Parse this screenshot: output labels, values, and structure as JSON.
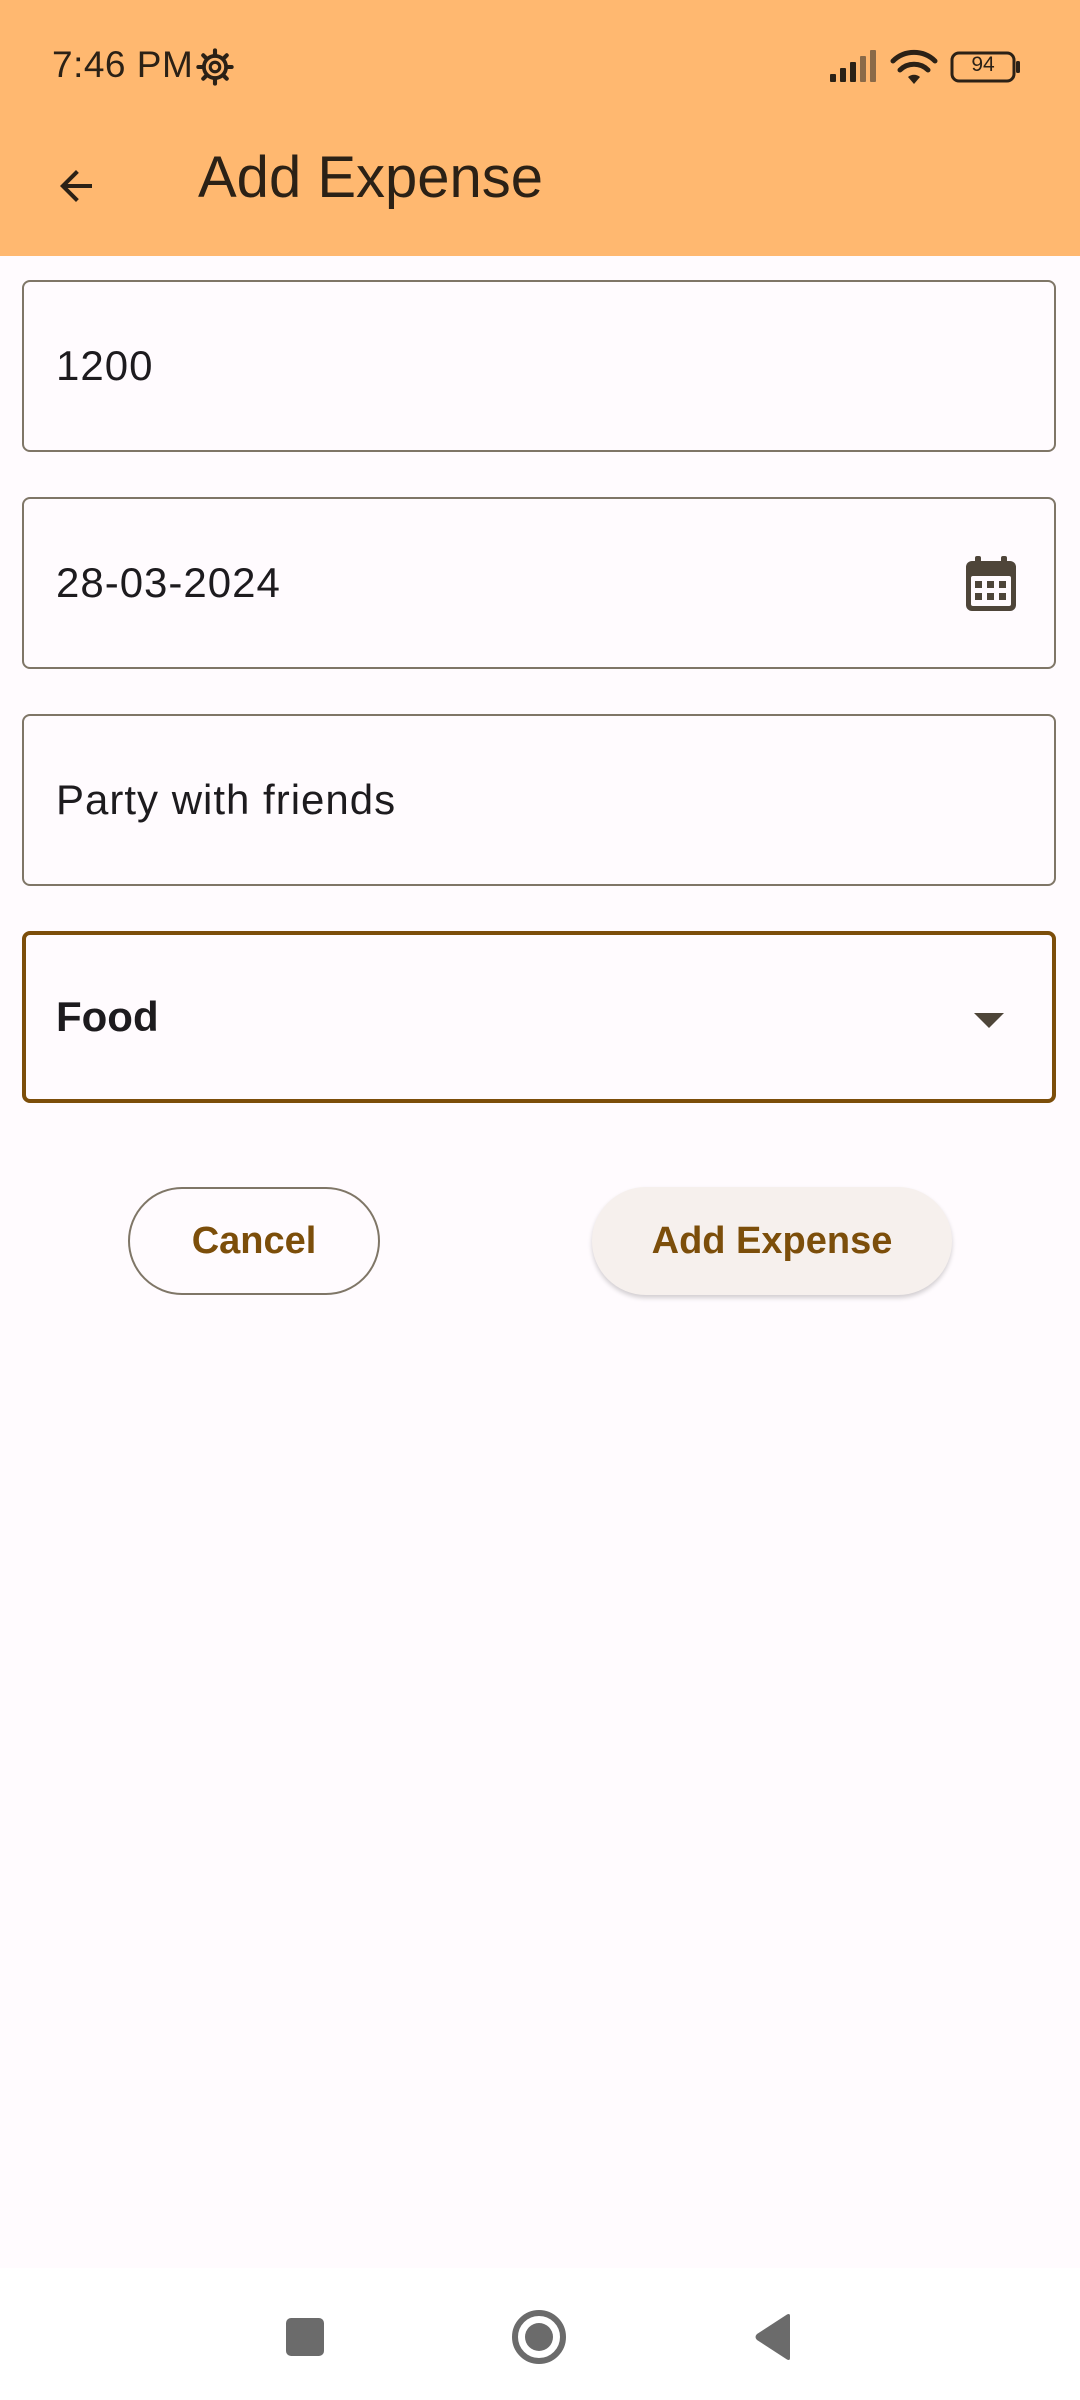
{
  "status_bar": {
    "time": "7:46 PM",
    "battery": "94",
    "icons": [
      "gear-icon",
      "signal-icon",
      "wifi-icon",
      "battery-icon"
    ]
  },
  "app_bar": {
    "title": "Add Expense",
    "back_icon": "arrow-back-icon"
  },
  "form": {
    "amount": {
      "value": "1200"
    },
    "date": {
      "value": "28-03-2024",
      "icon": "calendar-icon"
    },
    "description": {
      "value": "Party with friends"
    },
    "category": {
      "selected": "Food",
      "icon": "dropdown-arrow-icon"
    }
  },
  "actions": {
    "cancel_label": "Cancel",
    "add_label": "Add Expense"
  },
  "nav_bar": {
    "icons": [
      "recents-icon",
      "home-icon",
      "back-icon"
    ]
  },
  "colors": {
    "header": "#ffb870",
    "accent": "#7c4e0a",
    "outline": "#7f7667",
    "background": "#fffbfe",
    "button_tonal": "#f6f0ed"
  }
}
